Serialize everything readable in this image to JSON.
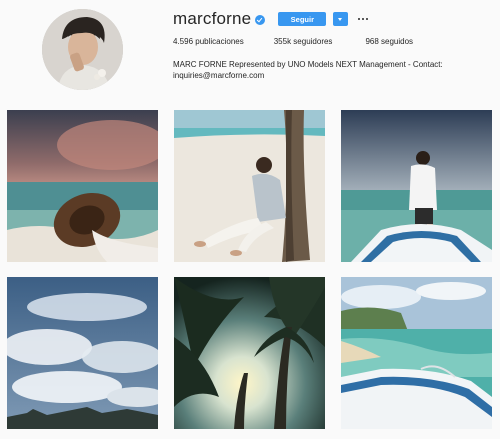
{
  "profile": {
    "username": "marcforne",
    "follow_label": "Seguir",
    "posts": "4.596 publicaciones",
    "followers": "355k seguidores",
    "following": "968 seguidos",
    "bio_line1": "MARC FORNE Represented by UNO Models NEXT Management - Contact:",
    "bio_line2": "inquiries@marcforne.com",
    "verified": true,
    "accent_color": "#3897f0"
  },
  "icons": {
    "verified": "verified-badge-icon",
    "dropdown": "chevron-down-icon",
    "more": "more-options-icon"
  },
  "posts": [
    {
      "subject": "hand holding straw hat at beach under pink sky"
    },
    {
      "subject": "man in white sitting on sand against palm tree"
    },
    {
      "subject": "man sitting on boat bow at sea"
    },
    {
      "subject": "cloudy sky over tree line"
    },
    {
      "subject": "palm trees against sunlight"
    },
    {
      "subject": "boat bow on turquoise water near island"
    }
  ]
}
